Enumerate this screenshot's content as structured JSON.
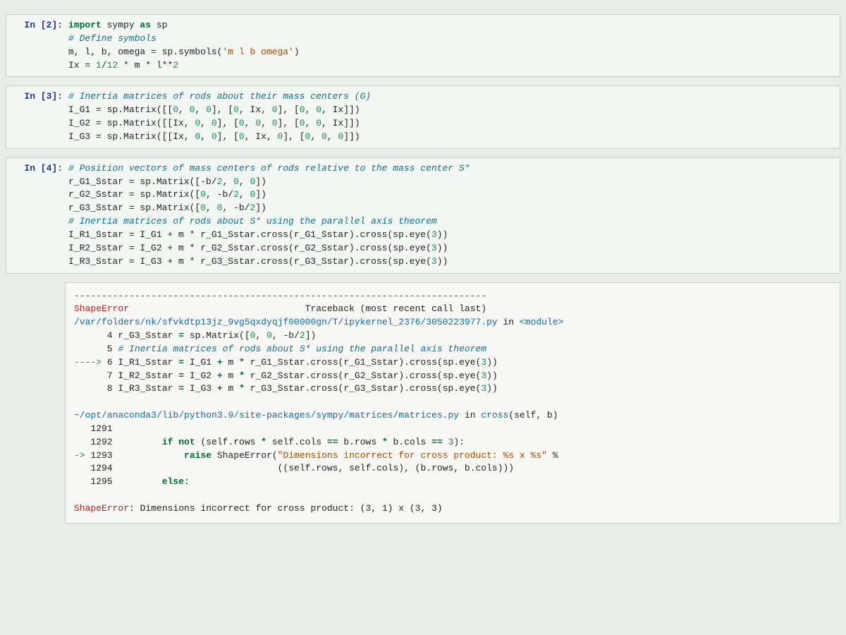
{
  "cells": [
    {
      "prompt": "In [2]:",
      "lines": [
        {
          "segs": [
            {
              "t": "import",
              "c": "kw"
            },
            {
              "t": " sympy "
            },
            {
              "t": "as",
              "c": "kw"
            },
            {
              "t": " sp"
            }
          ]
        },
        {
          "segs": [
            {
              "t": "# Define symbols",
              "c": "cmt"
            }
          ]
        },
        {
          "segs": [
            {
              "t": "m, l, b, omega = sp.symbols("
            },
            {
              "t": "'m l b omega'",
              "c": "str"
            },
            {
              "t": ")"
            }
          ]
        },
        {
          "segs": [
            {
              "t": "Ix = "
            },
            {
              "t": "1",
              "c": "num"
            },
            {
              "t": "/"
            },
            {
              "t": "12",
              "c": "num"
            },
            {
              "t": " * m * l**"
            },
            {
              "t": "2",
              "c": "num"
            }
          ]
        }
      ]
    },
    {
      "prompt": "In [3]:",
      "lines": [
        {
          "segs": [
            {
              "t": "# Inertia matrices of rods about their mass centers (G)",
              "c": "cmt"
            }
          ]
        },
        {
          "segs": [
            {
              "t": "I_G1 = sp.Matrix([["
            },
            {
              "t": "0",
              "c": "num"
            },
            {
              "t": ", "
            },
            {
              "t": "0",
              "c": "num"
            },
            {
              "t": ", "
            },
            {
              "t": "0",
              "c": "num"
            },
            {
              "t": "], ["
            },
            {
              "t": "0",
              "c": "num"
            },
            {
              "t": ", Ix, "
            },
            {
              "t": "0",
              "c": "num"
            },
            {
              "t": "], ["
            },
            {
              "t": "0",
              "c": "num"
            },
            {
              "t": ", "
            },
            {
              "t": "0",
              "c": "num"
            },
            {
              "t": ", Ix]])"
            }
          ]
        },
        {
          "segs": [
            {
              "t": "I_G2 = sp.Matrix([[Ix, "
            },
            {
              "t": "0",
              "c": "num"
            },
            {
              "t": ", "
            },
            {
              "t": "0",
              "c": "num"
            },
            {
              "t": "], ["
            },
            {
              "t": "0",
              "c": "num"
            },
            {
              "t": ", "
            },
            {
              "t": "0",
              "c": "num"
            },
            {
              "t": ", "
            },
            {
              "t": "0",
              "c": "num"
            },
            {
              "t": "], ["
            },
            {
              "t": "0",
              "c": "num"
            },
            {
              "t": ", "
            },
            {
              "t": "0",
              "c": "num"
            },
            {
              "t": ", Ix]])"
            }
          ]
        },
        {
          "segs": [
            {
              "t": "I_G3 = sp.Matrix([[Ix, "
            },
            {
              "t": "0",
              "c": "num"
            },
            {
              "t": ", "
            },
            {
              "t": "0",
              "c": "num"
            },
            {
              "t": "], ["
            },
            {
              "t": "0",
              "c": "num"
            },
            {
              "t": ", Ix, "
            },
            {
              "t": "0",
              "c": "num"
            },
            {
              "t": "], ["
            },
            {
              "t": "0",
              "c": "num"
            },
            {
              "t": ", "
            },
            {
              "t": "0",
              "c": "num"
            },
            {
              "t": ", "
            },
            {
              "t": "0",
              "c": "num"
            },
            {
              "t": "]])"
            }
          ]
        }
      ]
    },
    {
      "prompt": "In [4]:",
      "lines": [
        {
          "segs": [
            {
              "t": "# Position vectors of mass centers of rods relative to the mass center S*",
              "c": "cmt"
            }
          ]
        },
        {
          "segs": [
            {
              "t": "r_G1_Sstar = sp.Matrix([-b/"
            },
            {
              "t": "2",
              "c": "num"
            },
            {
              "t": ", "
            },
            {
              "t": "0",
              "c": "num"
            },
            {
              "t": ", "
            },
            {
              "t": "0",
              "c": "num"
            },
            {
              "t": "])"
            }
          ]
        },
        {
          "segs": [
            {
              "t": "r_G2_Sstar = sp.Matrix(["
            },
            {
              "t": "0",
              "c": "num"
            },
            {
              "t": ", -b/"
            },
            {
              "t": "2",
              "c": "num"
            },
            {
              "t": ", "
            },
            {
              "t": "0",
              "c": "num"
            },
            {
              "t": "])"
            }
          ]
        },
        {
          "segs": [
            {
              "t": "r_G3_Sstar = sp.Matrix(["
            },
            {
              "t": "0",
              "c": "num"
            },
            {
              "t": ", "
            },
            {
              "t": "0",
              "c": "num"
            },
            {
              "t": ", -b/"
            },
            {
              "t": "2",
              "c": "num"
            },
            {
              "t": "])"
            }
          ]
        },
        {
          "segs": [
            {
              "t": "# Inertia matrices of rods about S* using the parallel axis theorem",
              "c": "cmt"
            }
          ]
        },
        {
          "segs": [
            {
              "t": "I_R1_Sstar = I_G1 + m * r_G1_Sstar.cross(r_G1_Sstar).cross(sp.eye("
            },
            {
              "t": "3",
              "c": "num"
            },
            {
              "t": "))"
            }
          ]
        },
        {
          "segs": [
            {
              "t": "I_R2_Sstar = I_G2 + m * r_G2_Sstar.cross(r_G2_Sstar).cross(sp.eye("
            },
            {
              "t": "3",
              "c": "num"
            },
            {
              "t": "))"
            }
          ]
        },
        {
          "segs": [
            {
              "t": "I_R3_Sstar = I_G3 + m * r_G3_Sstar.cross(r_G3_Sstar).cross(sp.eye("
            },
            {
              "t": "3",
              "c": "num"
            },
            {
              "t": "))"
            }
          ]
        }
      ],
      "output": [
        {
          "segs": [
            {
              "t": "---------------------------------------------------------------------------",
              "c": "dash"
            }
          ]
        },
        {
          "segs": [
            {
              "t": "ShapeError",
              "c": "err"
            },
            {
              "t": "                                Traceback (most recent call last)"
            }
          ]
        },
        {
          "segs": [
            {
              "t": "/var/folders/nk/sfvkdtp13jz_9vg5qxdyqjf00000gn/T/ipykernel_2376/3050223977.py",
              "c": "path"
            },
            {
              "t": " in "
            },
            {
              "t": "<module>",
              "c": "fn"
            }
          ]
        },
        {
          "segs": [
            {
              "t": "      4"
            },
            {
              "t": " r_G3_Sstar "
            },
            {
              "t": "=",
              "c": "kw"
            },
            {
              "t": " sp.Matrix(["
            },
            {
              "t": "0",
              "c": "num"
            },
            {
              "t": ", "
            },
            {
              "t": "0",
              "c": "num"
            },
            {
              "t": ", -b/"
            },
            {
              "t": "2",
              "c": "num"
            },
            {
              "t": "])"
            }
          ]
        },
        {
          "segs": [
            {
              "t": "      5"
            },
            {
              "t": " "
            },
            {
              "t": "# Inertia matrices of rods about S* using the parallel axis theorem",
              "c": "cmt"
            }
          ]
        },
        {
          "segs": [
            {
              "t": "----> ",
              "c": "arrow"
            },
            {
              "t": "6"
            },
            {
              "t": " I_R1_Sstar "
            },
            {
              "t": "=",
              "c": "kw"
            },
            {
              "t": " I_G1 "
            },
            {
              "t": "+",
              "c": "kw"
            },
            {
              "t": " m "
            },
            {
              "t": "*",
              "c": "kw"
            },
            {
              "t": " r_G1_Sstar.cross(r_G1_Sstar).cross(sp.eye("
            },
            {
              "t": "3",
              "c": "num"
            },
            {
              "t": "))"
            }
          ]
        },
        {
          "segs": [
            {
              "t": "      7"
            },
            {
              "t": " I_R2_Sstar "
            },
            {
              "t": "=",
              "c": "kw"
            },
            {
              "t": " I_G2 "
            },
            {
              "t": "+",
              "c": "kw"
            },
            {
              "t": " m "
            },
            {
              "t": "*",
              "c": "kw"
            },
            {
              "t": " r_G2_Sstar.cross(r_G2_Sstar).cross(sp.eye("
            },
            {
              "t": "3",
              "c": "num"
            },
            {
              "t": "))"
            }
          ]
        },
        {
          "segs": [
            {
              "t": "      8"
            },
            {
              "t": " I_R3_Sstar "
            },
            {
              "t": "=",
              "c": "kw"
            },
            {
              "t": " I_G3 "
            },
            {
              "t": "+",
              "c": "kw"
            },
            {
              "t": " m "
            },
            {
              "t": "*",
              "c": "kw"
            },
            {
              "t": " r_G3_Sstar.cross(r_G3_Sstar).cross(sp.eye("
            },
            {
              "t": "3",
              "c": "num"
            },
            {
              "t": "))"
            }
          ]
        },
        {
          "segs": [
            {
              "t": " "
            }
          ]
        },
        {
          "segs": [
            {
              "t": "~/opt/anaconda3/lib/python3.9/site-packages/sympy/matrices/matrices.py",
              "c": "path"
            },
            {
              "t": " in "
            },
            {
              "t": "cross",
              "c": "fn"
            },
            {
              "t": "(self, b)"
            }
          ]
        },
        {
          "segs": [
            {
              "t": "   1291"
            }
          ]
        },
        {
          "segs": [
            {
              "t": "   1292"
            },
            {
              "t": "         "
            },
            {
              "t": "if not",
              "c": "kw"
            },
            {
              "t": " (self.rows "
            },
            {
              "t": "*",
              "c": "kw"
            },
            {
              "t": " self.cols "
            },
            {
              "t": "==",
              "c": "kw"
            },
            {
              "t": " b.rows "
            },
            {
              "t": "*",
              "c": "kw"
            },
            {
              "t": " b.cols "
            },
            {
              "t": "==",
              "c": "kw"
            },
            {
              "t": " "
            },
            {
              "t": "3",
              "c": "num"
            },
            {
              "t": "):"
            }
          ]
        },
        {
          "segs": [
            {
              "t": "-> ",
              "c": "arrow"
            },
            {
              "t": "1293"
            },
            {
              "t": "             "
            },
            {
              "t": "raise",
              "c": "kw"
            },
            {
              "t": " ShapeError("
            },
            {
              "t": "\"Dimensions incorrect for cross product: %s x %s\"",
              "c": "str"
            },
            {
              "t": " %"
            }
          ]
        },
        {
          "segs": [
            {
              "t": "   1294"
            },
            {
              "t": "                              ((self.rows, self.cols), (b.rows, b.cols)))"
            }
          ]
        },
        {
          "segs": [
            {
              "t": "   1295"
            },
            {
              "t": "         "
            },
            {
              "t": "else",
              "c": "kw"
            },
            {
              "t": ":"
            }
          ]
        },
        {
          "segs": [
            {
              "t": " "
            }
          ]
        },
        {
          "segs": [
            {
              "t": "ShapeError",
              "c": "err"
            },
            {
              "t": ": Dimensions incorrect for cross product: (3, 1) x (3, 3)"
            }
          ]
        }
      ]
    }
  ]
}
